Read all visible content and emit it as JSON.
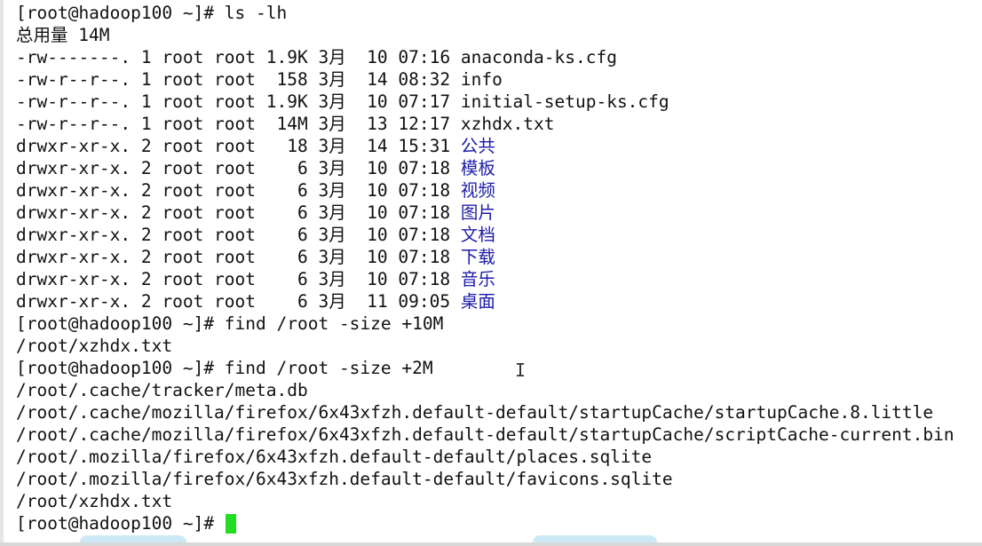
{
  "terminal": {
    "lines": [
      {
        "text": "[root@hadoop100 ~]# ls -lh"
      },
      {
        "text": "总用量 14M"
      },
      {
        "text": "-rw-------. 1 root root 1.9K 3月  10 07:16 ",
        "name": "anaconda-ks.cfg",
        "kind": "file"
      },
      {
        "text": "-rw-r--r--. 1 root root  158 3月  14 08:32 ",
        "name": "info",
        "kind": "file"
      },
      {
        "text": "-rw-r--r--. 1 root root 1.9K 3月  10 07:17 ",
        "name": "initial-setup-ks.cfg",
        "kind": "file"
      },
      {
        "text": "-rw-r--r--. 1 root root  14M 3月  13 12:17 ",
        "name": "xzhdx.txt",
        "kind": "file"
      },
      {
        "text": "drwxr-xr-x. 2 root root   18 3月  14 15:31 ",
        "name": "公共",
        "kind": "dir"
      },
      {
        "text": "drwxr-xr-x. 2 root root    6 3月  10 07:18 ",
        "name": "模板",
        "kind": "dir"
      },
      {
        "text": "drwxr-xr-x. 2 root root    6 3月  10 07:18 ",
        "name": "视频",
        "kind": "dir"
      },
      {
        "text": "drwxr-xr-x. 2 root root    6 3月  10 07:18 ",
        "name": "图片",
        "kind": "dir"
      },
      {
        "text": "drwxr-xr-x. 2 root root    6 3月  10 07:18 ",
        "name": "文档",
        "kind": "dir"
      },
      {
        "text": "drwxr-xr-x. 2 root root    6 3月  10 07:18 ",
        "name": "下载",
        "kind": "dir"
      },
      {
        "text": "drwxr-xr-x. 2 root root    6 3月  10 07:18 ",
        "name": "音乐",
        "kind": "dir"
      },
      {
        "text": "drwxr-xr-x. 2 root root    6 3月  11 09:05 ",
        "name": "桌面",
        "kind": "dir"
      },
      {
        "text": "[root@hadoop100 ~]# find /root -size +10M"
      },
      {
        "text": "/root/xzhdx.txt"
      },
      {
        "text": "[root@hadoop100 ~]# find /root -size +2M"
      },
      {
        "text": "/root/.cache/tracker/meta.db"
      },
      {
        "text": "/root/.cache/mozilla/firefox/6x43xfzh.default-default/startupCache/startupCache.8.little"
      },
      {
        "text": "/root/.cache/mozilla/firefox/6x43xfzh.default-default/startupCache/scriptCache-current.bin"
      },
      {
        "text": "/root/.mozilla/firefox/6x43xfzh.default-default/places.sqlite"
      },
      {
        "text": "/root/.mozilla/firefox/6x43xfzh.default-default/favicons.sqlite"
      },
      {
        "text": "/root/xzhdx.txt"
      },
      {
        "text": "[root@hadoop100 ~]# ",
        "cursor": true
      }
    ],
    "colors": {
      "directory": "#1c1ca8",
      "cursor": "#22dd22",
      "text": "#111111"
    },
    "mouse_cursor": "I"
  }
}
